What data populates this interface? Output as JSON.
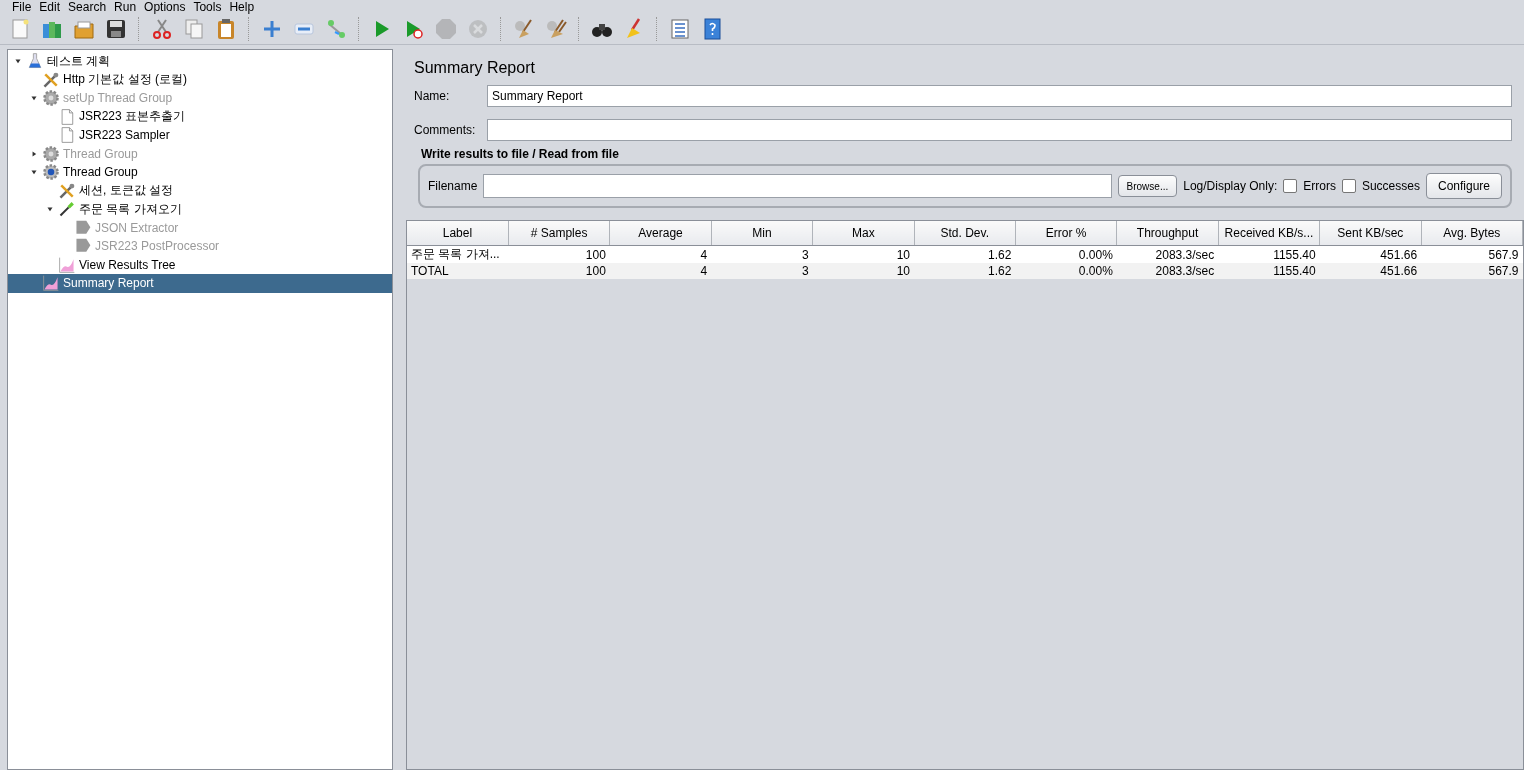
{
  "menu": [
    "File",
    "Edit",
    "Search",
    "Run",
    "Options",
    "Tools",
    "Help"
  ],
  "toolbar": [
    [
      {
        "kind": "new",
        "disabled": false
      },
      {
        "kind": "templates",
        "disabled": false
      },
      {
        "kind": "open",
        "disabled": false
      },
      {
        "kind": "save",
        "disabled": false
      }
    ],
    [
      {
        "kind": "cut",
        "disabled": false
      },
      {
        "kind": "copy",
        "disabled": false
      },
      {
        "kind": "paste",
        "disabled": false
      }
    ],
    [
      {
        "kind": "expand",
        "disabled": false
      },
      {
        "kind": "collapse",
        "disabled": false
      },
      {
        "kind": "toggle",
        "disabled": false
      }
    ],
    [
      {
        "kind": "start",
        "disabled": false
      },
      {
        "kind": "start-no-pause",
        "disabled": false
      },
      {
        "kind": "stop",
        "disabled": true
      },
      {
        "kind": "shutdown",
        "disabled": true
      }
    ],
    [
      {
        "kind": "clear",
        "disabled": false
      },
      {
        "kind": "clear-all",
        "disabled": false
      }
    ],
    [
      {
        "kind": "search",
        "disabled": false
      },
      {
        "kind": "reset-search",
        "disabled": false
      }
    ],
    [
      {
        "kind": "functions",
        "disabled": false
      },
      {
        "kind": "help",
        "disabled": false
      }
    ]
  ],
  "tree": [
    {
      "label": "테스트 계획",
      "kind": "plan",
      "enabled": true,
      "selected": false,
      "expanded": true,
      "children": [
        {
          "label": "Http 기본값 설정 (로컬)",
          "kind": "config",
          "enabled": true,
          "selected": false
        },
        {
          "label": "setUp Thread Group",
          "kind": "thread",
          "enabled": false,
          "selected": false,
          "expanded": true,
          "children": [
            {
              "label": "JSR223 표본추출기",
              "kind": "sampler",
              "enabled": true,
              "selected": false
            },
            {
              "label": "JSR223 Sampler",
              "kind": "sampler",
              "enabled": true,
              "selected": false
            }
          ]
        },
        {
          "label": "Thread Group",
          "kind": "thread",
          "enabled": false,
          "selected": false,
          "expanded": false
        },
        {
          "label": "Thread Group",
          "kind": "thread",
          "enabled": true,
          "selected": false,
          "expanded": true,
          "children": [
            {
              "label": "세션, 토큰값 설정",
              "kind": "config",
              "enabled": true,
              "selected": false
            },
            {
              "label": "주문 목록 가져오기",
              "kind": "http",
              "enabled": true,
              "selected": false,
              "expanded": true,
              "children": [
                {
                  "label": "JSON Extractor",
                  "kind": "post",
                  "enabled": false,
                  "selected": false
                },
                {
                  "label": "JSR223 PostProcessor",
                  "kind": "post",
                  "enabled": false,
                  "selected": false
                }
              ]
            },
            {
              "label": "View Results Tree",
              "kind": "listener",
              "enabled": true,
              "selected": false
            }
          ]
        },
        {
          "label": "Summary Report",
          "kind": "listener",
          "enabled": true,
          "selected": true
        }
      ]
    }
  ],
  "panel": {
    "title": "Summary Report",
    "name_label": "Name:",
    "name_value": "Summary Report",
    "comments_label": "Comments:",
    "file_group": {
      "title": "Write results to file / Read from file",
      "filename_label": "Filename",
      "browse": "Browse...",
      "log_label": "Log/Display Only:",
      "checks": [
        {
          "label": "Errors",
          "checked": false
        },
        {
          "label": "Successes",
          "checked": false
        }
      ],
      "configure": "Configure"
    },
    "table": {
      "columns": [
        "Label",
        "# Samples",
        "Average",
        "Min",
        "Max",
        "Std. Dev.",
        "Error %",
        "Throughput",
        "Received KB/s...",
        "Sent KB/sec",
        "Avg. Bytes"
      ],
      "rows": [
        [
          "주문 목록 가져...",
          "100",
          "4",
          "3",
          "10",
          "1.62",
          "0.00%",
          "2083.3/sec",
          "1155.40",
          "451.66",
          "567.9"
        ],
        [
          "TOTAL",
          "100",
          "4",
          "3",
          "10",
          "1.62",
          "0.00%",
          "2083.3/sec",
          "1155.40",
          "451.66",
          "567.9"
        ]
      ]
    }
  }
}
